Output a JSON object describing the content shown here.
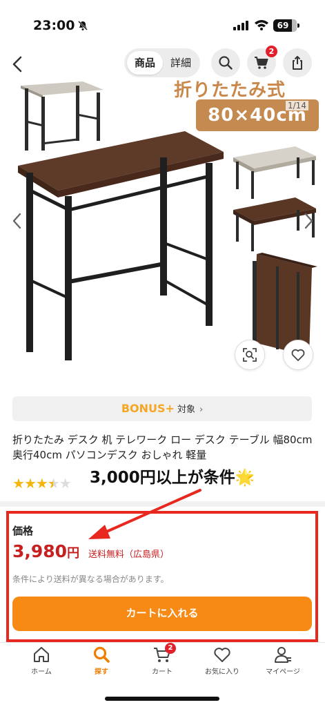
{
  "status_bar": {
    "time": "23:00",
    "battery": "69"
  },
  "nav": {
    "tab_product": "商品",
    "tab_detail": "詳細",
    "cart_count": "2"
  },
  "gallery": {
    "banner_text": "折りたたみ式",
    "size_label": "80×40cm",
    "page_indicator": "1/14"
  },
  "bonus": {
    "brand": "BONUS+",
    "label": "対象",
    "chevron": "›"
  },
  "product": {
    "title": "折りたたみ デスク 机 テレワーク ロー デスク テーブル 幅80cm 奥行40cm パソコンデスク おしゃれ 軽量",
    "rating": 3.5
  },
  "annotation": {
    "text": "3,000円以上が条件",
    "emoji": "🌟"
  },
  "price": {
    "label": "価格",
    "amount": "3,980",
    "yen": "円",
    "shipping": "送料無料（広島県）",
    "note": "条件により送料が異なる場合があります。",
    "cart_button": "カートに入れる"
  },
  "tabbar": {
    "items": [
      {
        "label": "ホーム",
        "icon": "home-icon"
      },
      {
        "label": "探す",
        "icon": "search-icon"
      },
      {
        "label": "カート",
        "icon": "cart-icon"
      },
      {
        "label": "お気に入り",
        "icon": "heart-icon"
      },
      {
        "label": "マイページ",
        "icon": "person-icon"
      }
    ],
    "cart_badge": "2"
  },
  "colors": {
    "accent": "#f78a14",
    "price_red": "#c72020",
    "highlight": "#e8281e"
  }
}
